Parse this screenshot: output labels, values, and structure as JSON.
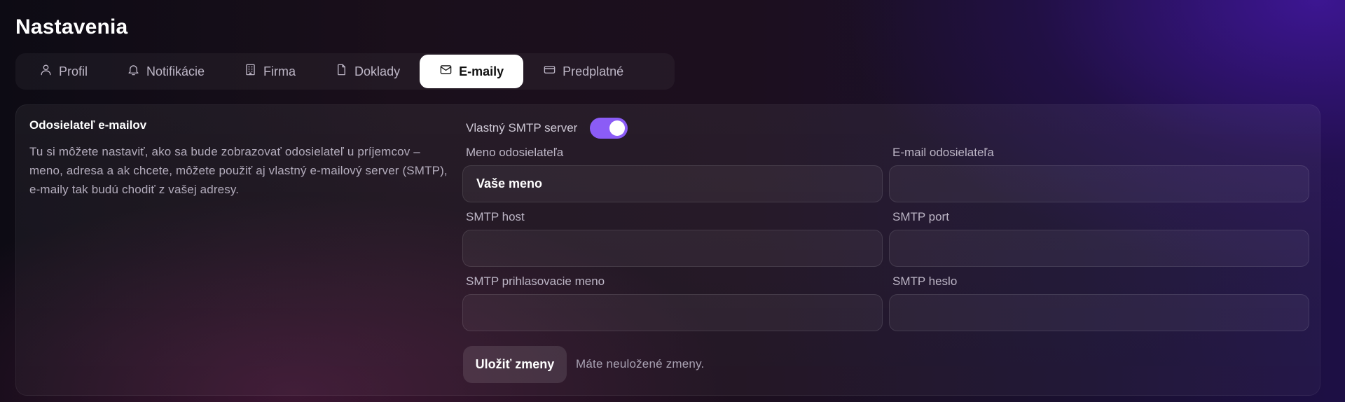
{
  "page": {
    "title": "Nastavenia"
  },
  "tabs": [
    {
      "label": "Profil",
      "icon": "user-icon"
    },
    {
      "label": "Notifikácie",
      "icon": "bell-icon"
    },
    {
      "label": "Firma",
      "icon": "building-icon"
    },
    {
      "label": "Doklady",
      "icon": "document-icon"
    },
    {
      "label": "E-maily",
      "icon": "mail-icon",
      "active": true
    },
    {
      "label": "Predplatné",
      "icon": "credit-card-icon"
    }
  ],
  "section": {
    "title": "Odosielateľ e-mailov",
    "description": "Tu si môžete nastaviť, ako sa bude zobrazovať odosielateľ u príjemcov – meno, adresa a ak chcete, môžete použiť aj vlastný e-mailový server (SMTP), e-maily tak budú chodiť z vašej adresy."
  },
  "smtp_toggle": {
    "label": "Vlastný SMTP server",
    "on": true,
    "color": "#8b5cf6"
  },
  "fields": {
    "sender_name": {
      "label": "Meno odosielateľa",
      "value": "Vaše meno"
    },
    "sender_email": {
      "label": "E-mail odosielateľa",
      "value": ""
    },
    "smtp_host": {
      "label": "SMTP host",
      "value": ""
    },
    "smtp_port": {
      "label": "SMTP port",
      "value": ""
    },
    "smtp_user": {
      "label": "SMTP prihlasovacie meno",
      "value": ""
    },
    "smtp_password": {
      "label": "SMTP heslo",
      "value": ""
    }
  },
  "actions": {
    "save_label": "Uložiť zmeny",
    "unsaved_text": "Máte neuložené zmeny."
  }
}
